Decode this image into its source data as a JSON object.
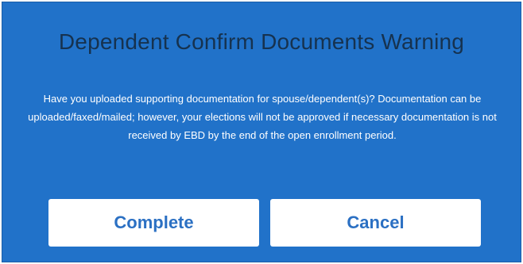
{
  "dialog": {
    "title": "Dependent Confirm Documents Warning",
    "message": "Have you uploaded supporting documentation for spouse/dependent(s)? Documentation can be uploaded/faxed/mailed; however, your elections will not be approved if necessary documentation is not received by EBD by the end of the open enrollment period.",
    "complete_label": "Complete",
    "cancel_label": "Cancel"
  },
  "colors": {
    "dialog_background": "#2172c9",
    "title_text": "#16324f",
    "message_text": "#ffffff",
    "button_background": "#ffffff",
    "button_text": "#2b70c3"
  }
}
